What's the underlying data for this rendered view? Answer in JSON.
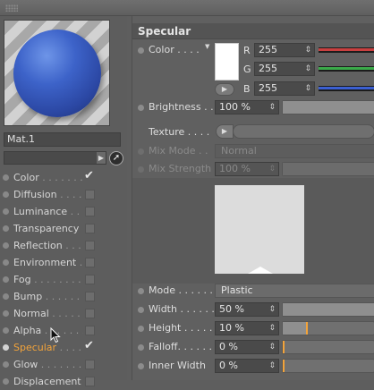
{
  "material": {
    "name": "Mat.1"
  },
  "channels": [
    {
      "label": "Color",
      "dots": "Color . . . . . . . . .",
      "checked": true,
      "active": false
    },
    {
      "label": "Diffusion",
      "dots": "Diffusion . . . . . . .",
      "checked": false,
      "active": false
    },
    {
      "label": "Luminance",
      "dots": "Luminance . . . . . .",
      "checked": false,
      "active": false
    },
    {
      "label": "Transparency",
      "dots": "Transparency",
      "checked": false,
      "active": false
    },
    {
      "label": "Reflection",
      "dots": "Reflection . . . . . .",
      "checked": false,
      "active": false
    },
    {
      "label": "Environment",
      "dots": "Environment",
      "checked": false,
      "active": false
    },
    {
      "label": "Fog",
      "dots": "Fog . . . . . . . . . . . .",
      "checked": false,
      "active": false
    },
    {
      "label": "Bump",
      "dots": "Bump . . . . . . . . . .",
      "checked": false,
      "active": false
    },
    {
      "label": "Normal",
      "dots": "Normal. . . . . . . . .",
      "checked": false,
      "active": false
    },
    {
      "label": "Alpha",
      "dots": "Alpha . . . . . . . . . .",
      "checked": false,
      "active": false
    },
    {
      "label": "Specular",
      "dots": "Specular . . . . . . .",
      "checked": true,
      "active": true
    },
    {
      "label": "Glow",
      "dots": "Glow. . . . . . . . . . .",
      "checked": false,
      "active": false
    },
    {
      "label": "Displacement",
      "dots": "Displacement",
      "checked": false,
      "active": false
    }
  ],
  "specular": {
    "title": "Specular",
    "color_label": "Color . . . .",
    "color_swatch": "#ffffff",
    "r_label": "R",
    "r_value": "255",
    "g_label": "G",
    "g_value": "255",
    "b_label": "B",
    "b_value": "255",
    "brightness_label": "Brightness . .",
    "brightness_value": "100 %",
    "texture_label": "Texture . . . .",
    "mixmode_label": "Mix Mode . .",
    "mixmode_value": "Normal",
    "mixstrength_label": "Mix Strength",
    "mixstrength_value": "100 %",
    "mode_label": "Mode . . . . . .",
    "mode_value": "Plastic",
    "width_label": "Width . . . . . .",
    "width_value": "50 %",
    "height_label": "Height . . . . .",
    "height_value": "10 %",
    "height_fraction": 0.1,
    "falloff_label": "Falloff. . . . . .",
    "falloff_value": "0 %",
    "innerwidth_label": "Inner Width",
    "innerwidth_value": "0 %"
  },
  "colors": {
    "accent": "#f2a33a",
    "panel": "#5e5e5e",
    "r_bar": "#d23b3b",
    "g_bar": "#3bb34a",
    "b_bar": "#3b5fd2"
  }
}
